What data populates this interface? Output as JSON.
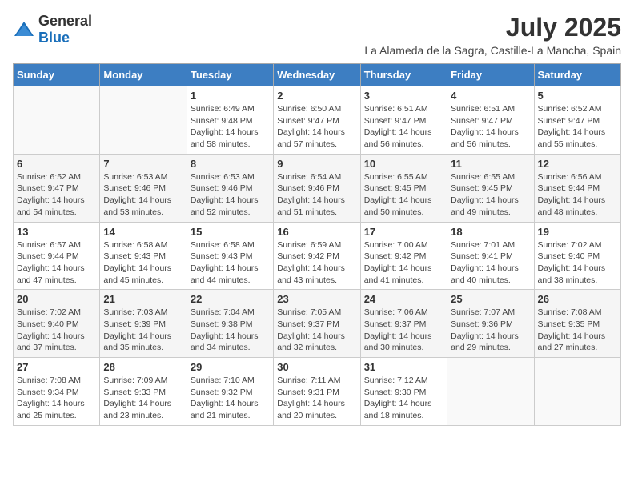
{
  "logo": {
    "text_general": "General",
    "text_blue": "Blue"
  },
  "title": "July 2025",
  "subtitle": "La Alameda de la Sagra, Castille-La Mancha, Spain",
  "days_of_week": [
    "Sunday",
    "Monday",
    "Tuesday",
    "Wednesday",
    "Thursday",
    "Friday",
    "Saturday"
  ],
  "weeks": [
    [
      {
        "num": "",
        "sunrise": "",
        "sunset": "",
        "daylight": ""
      },
      {
        "num": "",
        "sunrise": "",
        "sunset": "",
        "daylight": ""
      },
      {
        "num": "1",
        "sunrise": "Sunrise: 6:49 AM",
        "sunset": "Sunset: 9:48 PM",
        "daylight": "Daylight: 14 hours and 58 minutes."
      },
      {
        "num": "2",
        "sunrise": "Sunrise: 6:50 AM",
        "sunset": "Sunset: 9:47 PM",
        "daylight": "Daylight: 14 hours and 57 minutes."
      },
      {
        "num": "3",
        "sunrise": "Sunrise: 6:51 AM",
        "sunset": "Sunset: 9:47 PM",
        "daylight": "Daylight: 14 hours and 56 minutes."
      },
      {
        "num": "4",
        "sunrise": "Sunrise: 6:51 AM",
        "sunset": "Sunset: 9:47 PM",
        "daylight": "Daylight: 14 hours and 56 minutes."
      },
      {
        "num": "5",
        "sunrise": "Sunrise: 6:52 AM",
        "sunset": "Sunset: 9:47 PM",
        "daylight": "Daylight: 14 hours and 55 minutes."
      }
    ],
    [
      {
        "num": "6",
        "sunrise": "Sunrise: 6:52 AM",
        "sunset": "Sunset: 9:47 PM",
        "daylight": "Daylight: 14 hours and 54 minutes."
      },
      {
        "num": "7",
        "sunrise": "Sunrise: 6:53 AM",
        "sunset": "Sunset: 9:46 PM",
        "daylight": "Daylight: 14 hours and 53 minutes."
      },
      {
        "num": "8",
        "sunrise": "Sunrise: 6:53 AM",
        "sunset": "Sunset: 9:46 PM",
        "daylight": "Daylight: 14 hours and 52 minutes."
      },
      {
        "num": "9",
        "sunrise": "Sunrise: 6:54 AM",
        "sunset": "Sunset: 9:46 PM",
        "daylight": "Daylight: 14 hours and 51 minutes."
      },
      {
        "num": "10",
        "sunrise": "Sunrise: 6:55 AM",
        "sunset": "Sunset: 9:45 PM",
        "daylight": "Daylight: 14 hours and 50 minutes."
      },
      {
        "num": "11",
        "sunrise": "Sunrise: 6:55 AM",
        "sunset": "Sunset: 9:45 PM",
        "daylight": "Daylight: 14 hours and 49 minutes."
      },
      {
        "num": "12",
        "sunrise": "Sunrise: 6:56 AM",
        "sunset": "Sunset: 9:44 PM",
        "daylight": "Daylight: 14 hours and 48 minutes."
      }
    ],
    [
      {
        "num": "13",
        "sunrise": "Sunrise: 6:57 AM",
        "sunset": "Sunset: 9:44 PM",
        "daylight": "Daylight: 14 hours and 47 minutes."
      },
      {
        "num": "14",
        "sunrise": "Sunrise: 6:58 AM",
        "sunset": "Sunset: 9:43 PM",
        "daylight": "Daylight: 14 hours and 45 minutes."
      },
      {
        "num": "15",
        "sunrise": "Sunrise: 6:58 AM",
        "sunset": "Sunset: 9:43 PM",
        "daylight": "Daylight: 14 hours and 44 minutes."
      },
      {
        "num": "16",
        "sunrise": "Sunrise: 6:59 AM",
        "sunset": "Sunset: 9:42 PM",
        "daylight": "Daylight: 14 hours and 43 minutes."
      },
      {
        "num": "17",
        "sunrise": "Sunrise: 7:00 AM",
        "sunset": "Sunset: 9:42 PM",
        "daylight": "Daylight: 14 hours and 41 minutes."
      },
      {
        "num": "18",
        "sunrise": "Sunrise: 7:01 AM",
        "sunset": "Sunset: 9:41 PM",
        "daylight": "Daylight: 14 hours and 40 minutes."
      },
      {
        "num": "19",
        "sunrise": "Sunrise: 7:02 AM",
        "sunset": "Sunset: 9:40 PM",
        "daylight": "Daylight: 14 hours and 38 minutes."
      }
    ],
    [
      {
        "num": "20",
        "sunrise": "Sunrise: 7:02 AM",
        "sunset": "Sunset: 9:40 PM",
        "daylight": "Daylight: 14 hours and 37 minutes."
      },
      {
        "num": "21",
        "sunrise": "Sunrise: 7:03 AM",
        "sunset": "Sunset: 9:39 PM",
        "daylight": "Daylight: 14 hours and 35 minutes."
      },
      {
        "num": "22",
        "sunrise": "Sunrise: 7:04 AM",
        "sunset": "Sunset: 9:38 PM",
        "daylight": "Daylight: 14 hours and 34 minutes."
      },
      {
        "num": "23",
        "sunrise": "Sunrise: 7:05 AM",
        "sunset": "Sunset: 9:37 PM",
        "daylight": "Daylight: 14 hours and 32 minutes."
      },
      {
        "num": "24",
        "sunrise": "Sunrise: 7:06 AM",
        "sunset": "Sunset: 9:37 PM",
        "daylight": "Daylight: 14 hours and 30 minutes."
      },
      {
        "num": "25",
        "sunrise": "Sunrise: 7:07 AM",
        "sunset": "Sunset: 9:36 PM",
        "daylight": "Daylight: 14 hours and 29 minutes."
      },
      {
        "num": "26",
        "sunrise": "Sunrise: 7:08 AM",
        "sunset": "Sunset: 9:35 PM",
        "daylight": "Daylight: 14 hours and 27 minutes."
      }
    ],
    [
      {
        "num": "27",
        "sunrise": "Sunrise: 7:08 AM",
        "sunset": "Sunset: 9:34 PM",
        "daylight": "Daylight: 14 hours and 25 minutes."
      },
      {
        "num": "28",
        "sunrise": "Sunrise: 7:09 AM",
        "sunset": "Sunset: 9:33 PM",
        "daylight": "Daylight: 14 hours and 23 minutes."
      },
      {
        "num": "29",
        "sunrise": "Sunrise: 7:10 AM",
        "sunset": "Sunset: 9:32 PM",
        "daylight": "Daylight: 14 hours and 21 minutes."
      },
      {
        "num": "30",
        "sunrise": "Sunrise: 7:11 AM",
        "sunset": "Sunset: 9:31 PM",
        "daylight": "Daylight: 14 hours and 20 minutes."
      },
      {
        "num": "31",
        "sunrise": "Sunrise: 7:12 AM",
        "sunset": "Sunset: 9:30 PM",
        "daylight": "Daylight: 14 hours and 18 minutes."
      },
      {
        "num": "",
        "sunrise": "",
        "sunset": "",
        "daylight": ""
      },
      {
        "num": "",
        "sunrise": "",
        "sunset": "",
        "daylight": ""
      }
    ]
  ]
}
